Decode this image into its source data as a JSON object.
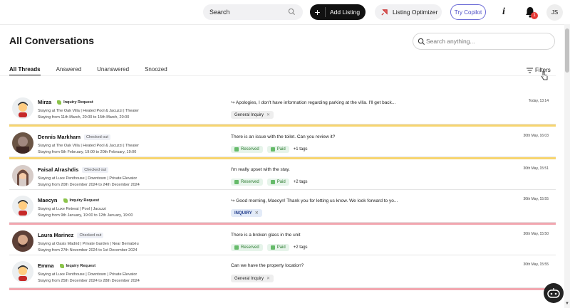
{
  "topbar": {
    "search_label": "Search",
    "add_listing_label": "Add Listing",
    "optimizer_label": "Listing Optimizer",
    "copilot_label": "Try Copilot",
    "info_label": "i",
    "notification_count": "1",
    "user_initials": "JS"
  },
  "page": {
    "title": "All Conversations",
    "search_placeholder": "Search anything...",
    "filters_label": "Filters"
  },
  "tabs": [
    "All Threads",
    "Answered",
    "Unanswered",
    "Snoozed"
  ],
  "colors": {
    "accent_yellow": "#f7d56f",
    "accent_pink": "#f2a7b0",
    "inquiry_blue": "#1f3a8a",
    "paid_green": "#2e7d32"
  },
  "conversations": [
    {
      "name": "Mirza",
      "status": "Inquiry Request",
      "staying": "Staying at The Oak Villa | Heated Pool & Jacuzzi | Theater",
      "dates": "Staying from 11th March, 20:00 to 15th March, 20:00",
      "message": "↪ Apologies, I don't have information regarding parking at the villa. I'll get back...",
      "tags": [
        "General Inquiry"
      ],
      "time": "Today, 13:14"
    },
    {
      "name": "Dennis Markham",
      "status": "Checked out",
      "staying": "Staying at The Oak Villa | Heated Pool & Jacuzzi | Theater",
      "dates": "Staying from 6th February, 19:00 to 20th February, 19:00",
      "message": "There is an issue with the toilet. Can you review it?",
      "tags": [
        "Reserved",
        "Paid"
      ],
      "more": "+1 tags",
      "time": "30th May, 16:03"
    },
    {
      "name": "Faisal Alrashdis",
      "status": "Checked out",
      "staying": "Staying at Luxe Penthouse | Downtown | Private Elevator",
      "dates": "Staying from 20th December 2024 to 24th December 2024",
      "message": "I'm really upset with the stay.",
      "tags": [
        "Reserved",
        "Paid"
      ],
      "more": "+2 tags",
      "time": "30th May, 15:51"
    },
    {
      "name": "Maecyn",
      "status": "Inquiry Request",
      "staying": "Staying at Luxe Retreat | Pool | Jacuzzi",
      "dates": "Staying from 9th January, 19:00 to 12th January, 19:00",
      "message": "↪ Good morning, Maecyn! Thank you for letting us know. We look forward to yo...",
      "tags": [
        "INQUIRY"
      ],
      "time": "30th May, 15:55"
    },
    {
      "name": "Laura Marinez",
      "status": "Checked out",
      "staying": "Staying at Oasis Madrid | Private Garden | Near Bernabéu",
      "dates": "Staying from 27th November 2024 to 1st December 2024",
      "message": "There is a broken glass in the unit",
      "tags": [
        "Reserved",
        "Paid"
      ],
      "more": "+2 tags",
      "time": "30th May, 15:50"
    },
    {
      "name": "Emma",
      "status": "Inquiry Request",
      "staying": "Staying at Luxe Penthouse | Downtown | Private Elevator",
      "dates": "Staying from 25th December 2024 to 28th December 2024",
      "message": "Can we have the property location?",
      "tags": [
        "General Inquiry"
      ],
      "time": "30th May, 15:55"
    }
  ]
}
